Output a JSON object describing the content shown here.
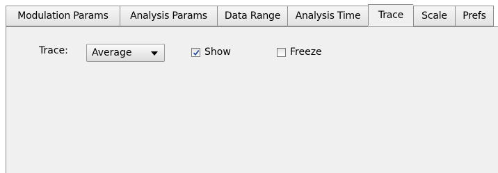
{
  "tabs": [
    {
      "label": "Modulation Params",
      "active": false
    },
    {
      "label": "Analysis Params",
      "active": false
    },
    {
      "label": "Data Range",
      "active": false
    },
    {
      "label": "Analysis Time",
      "active": false
    },
    {
      "label": "Trace",
      "active": true
    },
    {
      "label": "Scale",
      "active": false
    },
    {
      "label": "Prefs",
      "active": false
    }
  ],
  "trace": {
    "label": "Trace:",
    "selected": "Average",
    "show": {
      "label": "Show",
      "checked": true
    },
    "freeze": {
      "label": "Freeze",
      "checked": false
    }
  }
}
